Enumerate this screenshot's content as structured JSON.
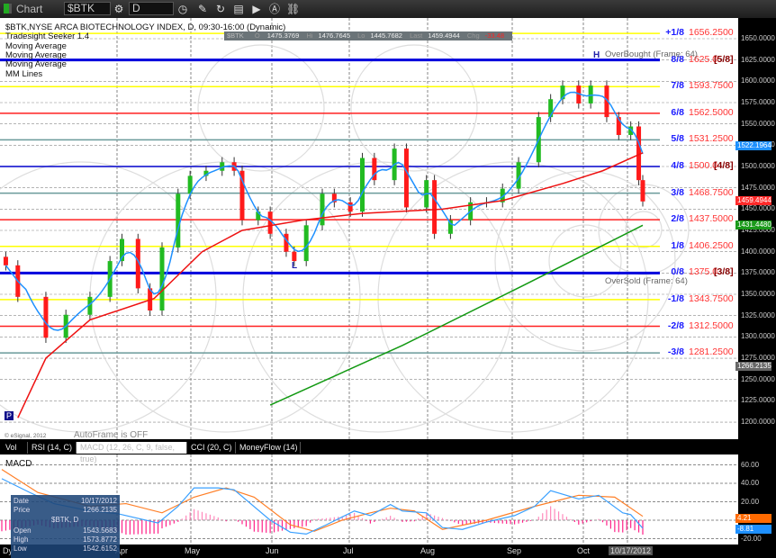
{
  "toolbar": {
    "title": "Chart",
    "symbol": "$BTK",
    "interval": "D"
  },
  "legend": {
    "title": "$BTK,NYSE ARCA BIOTECHNOLOGY INDEX, D, 09:30-16:00 (Dynamic)",
    "studies": [
      "Tradesight Seeker 1.4",
      "Moving Average",
      "Moving Average",
      "Moving Average",
      "MM Lines"
    ]
  },
  "quote": {
    "sym": "$BTK",
    "o_label": "O",
    "o": "1475.3769",
    "h_label": "Hi",
    "h": "1476.7645",
    "l_label": "Lo",
    "l": "1445.7682",
    "last_label": "Last",
    "last": "1459.4944",
    "chg_label": "Chg",
    "chg": "-33.48"
  },
  "mm_lines": [
    {
      "label": "+1/8",
      "value": "1656.2500",
      "price": 1656.25,
      "color": "#ffff00"
    },
    {
      "label": "8/8",
      "value": "1625.0",
      "price": 1625,
      "color": "#0000dd",
      "tag": "[5/8]",
      "thick": true
    },
    {
      "label": "7/8",
      "value": "1593.7500",
      "price": 1593.75,
      "color": "#ffff00"
    },
    {
      "label": "6/8",
      "value": "1562.5000",
      "price": 1562.5,
      "color": "#ff2020"
    },
    {
      "label": "5/8",
      "value": "1531.2500",
      "price": 1531.25,
      "color": "#6a9a9a"
    },
    {
      "label": "4/8",
      "value": "1500.0",
      "price": 1500,
      "color": "#0000cc",
      "tag": "[4/8]"
    },
    {
      "label": "3/8",
      "value": "1468.7500",
      "price": 1468.75,
      "color": "#6a9a9a"
    },
    {
      "label": "2/8",
      "value": "1437.5000",
      "price": 1437.5,
      "color": "#ff2020"
    },
    {
      "label": "1/8",
      "value": "1406.2500",
      "price": 1406.25,
      "color": "#ffff00"
    },
    {
      "label": "0/8",
      "value": "1375.0",
      "price": 1375,
      "color": "#0000dd",
      "tag": "[3/8]",
      "thick": true
    },
    {
      "label": "-1/8",
      "value": "1343.7500",
      "price": 1343.75,
      "color": "#ffff00"
    },
    {
      "label": "-2/8",
      "value": "1312.5000",
      "price": 1312.5,
      "color": "#ff2020"
    },
    {
      "label": "-3/8",
      "value": "1281.2500",
      "price": 1281.25,
      "color": "#6a9a9a"
    }
  ],
  "annotations": {
    "overbought": "OverBought (Frame: 64)",
    "oversold": "OverSold (Frame: 64)",
    "high_mark": "H",
    "low_mark": "L",
    "p_mark": "P",
    "copyright": "© eSignal, 2012",
    "autoframe": "AutoFrame is OFF"
  },
  "price_tags": {
    "ma_fast": "1522.1964",
    "last": "1459.4944",
    "ma_long": "1431.4480",
    "cursor": "1266.2135"
  },
  "tabs": [
    "Vol",
    "RSI (14, C)",
    "MACD (12, 26, C, 9, false, true)",
    "CCI (20, C)",
    "MoneyFlow (14)"
  ],
  "macd_title": "MACD",
  "macd_tags": {
    "signal": "4.21",
    "macd": "-8.81"
  },
  "months": [
    "Apr",
    "May",
    "Jun",
    "Jul",
    "Aug",
    "Sep",
    "Oct"
  ],
  "date_cursor": "10/17/2012",
  "axis_left_label": "Dy",
  "info": {
    "date_label": "Date",
    "date": "10/17/2012",
    "price_label": "Price",
    "price": "1266.2135",
    "sym": "$BTK, D",
    "open_label": "Open",
    "open": "1543.5683",
    "high_label": "High",
    "high": "1573.8772",
    "low_label": "Low",
    "low": "1542.6152"
  },
  "chart_data": {
    "type": "candlestick",
    "title": "$BTK daily",
    "ylim": [
      1200,
      1650
    ],
    "yticks": [
      1200,
      1225,
      1250,
      1275,
      1300,
      1325,
      1350,
      1375,
      1400,
      1425,
      1450,
      1475,
      1500,
      1525,
      1550,
      1575,
      1600,
      1625,
      1650
    ],
    "closes": [
      [
        1,
        1384
      ],
      [
        4,
        1347
      ],
      [
        11,
        1299
      ],
      [
        16,
        1326
      ],
      [
        22,
        1347
      ],
      [
        27,
        1389
      ],
      [
        30,
        1415
      ],
      [
        34,
        1357
      ],
      [
        37,
        1331
      ],
      [
        40,
        1405
      ],
      [
        44,
        1468
      ],
      [
        47,
        1489
      ],
      [
        51,
        1495
      ],
      [
        55,
        1505
      ],
      [
        58,
        1495
      ],
      [
        60,
        1437
      ],
      [
        64,
        1447
      ],
      [
        67,
        1421
      ],
      [
        71,
        1400
      ],
      [
        73,
        1389
      ],
      [
        76,
        1431
      ],
      [
        80,
        1468
      ],
      [
        83,
        1458
      ],
      [
        87,
        1447
      ],
      [
        90,
        1510
      ],
      [
        93,
        1484
      ],
      [
        98,
        1521
      ],
      [
        101,
        1452
      ],
      [
        106,
        1484
      ],
      [
        108,
        1421
      ],
      [
        112,
        1437
      ],
      [
        117,
        1458
      ],
      [
        121,
        1458
      ],
      [
        125,
        1474
      ],
      [
        129,
        1505
      ],
      [
        134,
        1558
      ],
      [
        137,
        1579
      ],
      [
        140,
        1595
      ],
      [
        144,
        1574
      ],
      [
        147,
        1595
      ],
      [
        151,
        1558
      ],
      [
        154,
        1537
      ],
      [
        157,
        1547
      ],
      [
        159,
        1484
      ],
      [
        160,
        1459
      ]
    ],
    "ma_mid": [
      [
        4,
        1205
      ],
      [
        11,
        1275
      ],
      [
        22,
        1320
      ],
      [
        38,
        1345
      ],
      [
        50,
        1400
      ],
      [
        60,
        1425
      ],
      [
        75,
        1437
      ],
      [
        90,
        1445
      ],
      [
        110,
        1450
      ],
      [
        125,
        1460
      ],
      [
        140,
        1480
      ],
      [
        150,
        1495
      ],
      [
        160,
        1516
      ]
    ],
    "ma_long": [
      [
        67,
        1220
      ],
      [
        100,
        1290
      ],
      [
        130,
        1360
      ],
      [
        160,
        1431
      ]
    ],
    "macd": {
      "ylim": [
        -20,
        60
      ],
      "yticks": [
        "60.00",
        "40.00",
        "20.00",
        "0.00",
        "-20.00"
      ],
      "macd_line": [
        [
          0,
          45
        ],
        [
          7,
          30
        ],
        [
          13,
          18
        ],
        [
          22,
          10
        ],
        [
          29,
          7
        ],
        [
          39,
          -3
        ],
        [
          44,
          15
        ],
        [
          48,
          35
        ],
        [
          54,
          35
        ],
        [
          58,
          33
        ],
        [
          67,
          0
        ],
        [
          72,
          -13
        ],
        [
          76,
          -15
        ],
        [
          81,
          -5
        ],
        [
          88,
          10
        ],
        [
          92,
          5
        ],
        [
          97,
          17
        ],
        [
          100,
          10
        ],
        [
          106,
          8
        ],
        [
          110,
          -8
        ],
        [
          115,
          -10
        ],
        [
          121,
          -2
        ],
        [
          128,
          5
        ],
        [
          133,
          15
        ],
        [
          137,
          32
        ],
        [
          144,
          23
        ],
        [
          149,
          27
        ],
        [
          155,
          8
        ],
        [
          157,
          6
        ],
        [
          160,
          -8.81
        ]
      ],
      "signal_line": [
        [
          0,
          55
        ],
        [
          9,
          30
        ],
        [
          22,
          15
        ],
        [
          31,
          18
        ],
        [
          40,
          8
        ],
        [
          48,
          25
        ],
        [
          56,
          35
        ],
        [
          63,
          25
        ],
        [
          72,
          -5
        ],
        [
          78,
          -12
        ],
        [
          85,
          0
        ],
        [
          92,
          8
        ],
        [
          97,
          13
        ],
        [
          103,
          10
        ],
        [
          110,
          -10
        ],
        [
          121,
          0
        ],
        [
          133,
          15
        ],
        [
          144,
          27
        ],
        [
          153,
          25
        ],
        [
          160,
          4.21
        ]
      ]
    }
  }
}
